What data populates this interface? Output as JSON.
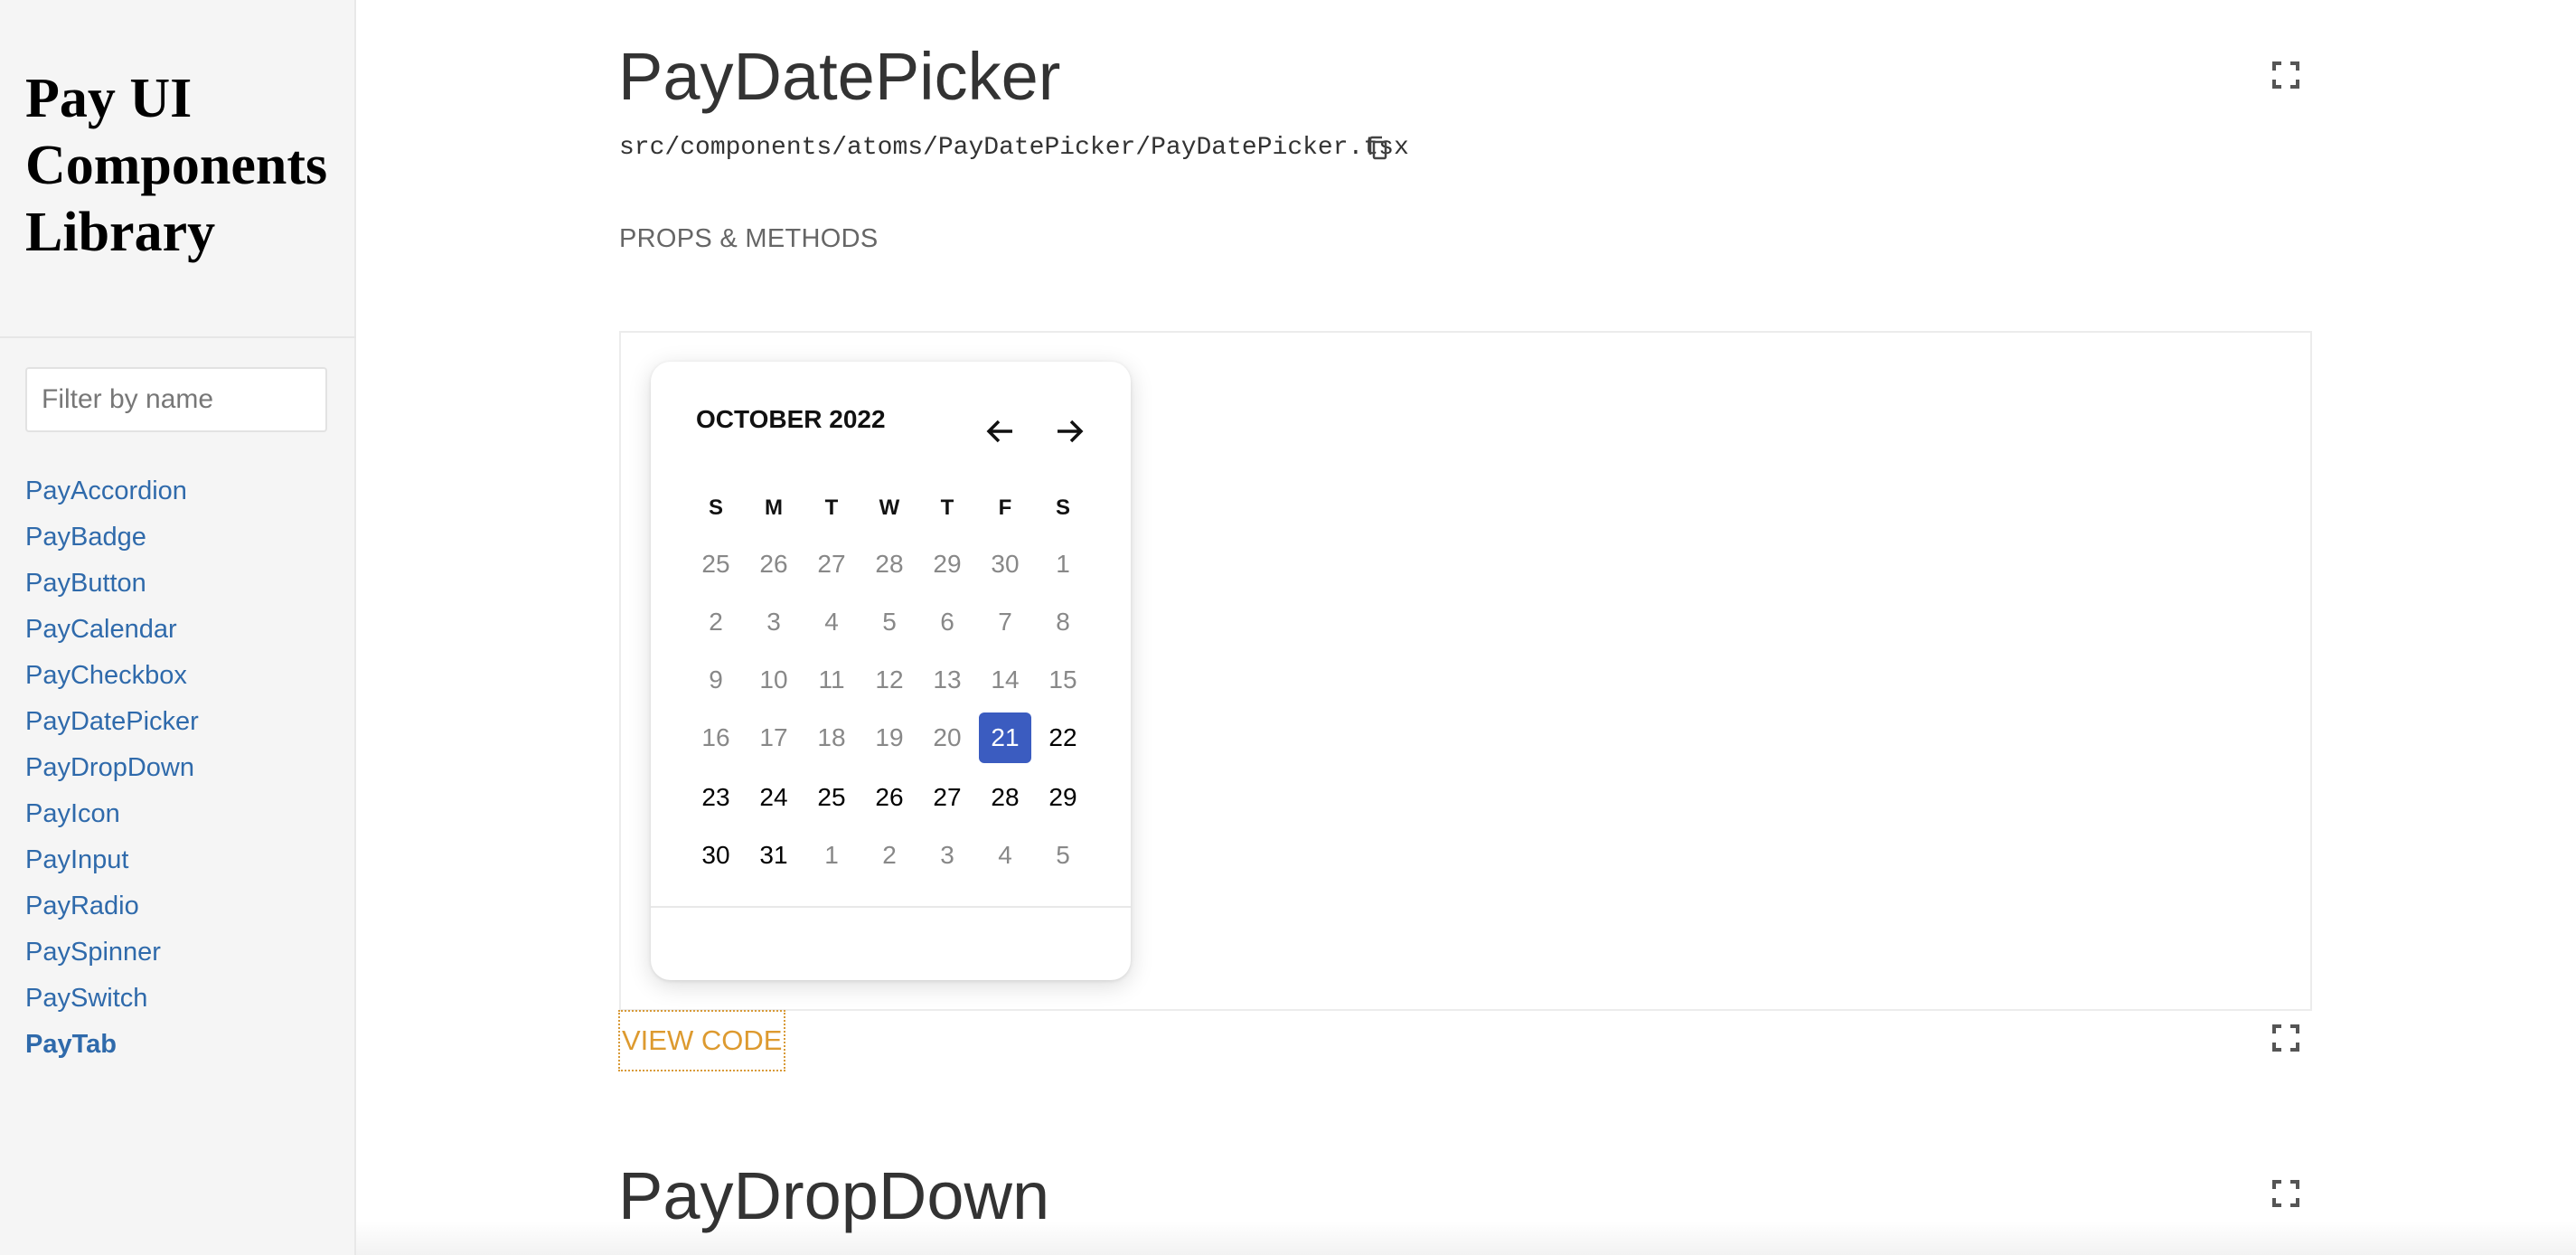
{
  "sidebar": {
    "brand": "Pay UI Components Library",
    "filter_placeholder": "Filter by name",
    "items": [
      {
        "label": "PayAccordion"
      },
      {
        "label": "PayBadge"
      },
      {
        "label": "PayButton"
      },
      {
        "label": "PayCalendar"
      },
      {
        "label": "PayCheckbox"
      },
      {
        "label": "PayDatePicker"
      },
      {
        "label": "PayDropDown"
      },
      {
        "label": "PayIcon"
      },
      {
        "label": "PayInput"
      },
      {
        "label": "PayRadio"
      },
      {
        "label": "PaySpinner"
      },
      {
        "label": "PaySwitch"
      },
      {
        "label": "PayTab"
      }
    ],
    "active_item": "PayTab"
  },
  "main": {
    "section1": {
      "title": "PayDatePicker",
      "path": "src/components/atoms/PayDatePicker/PayDatePicker.tsx",
      "props_label": "PROPS & METHODS",
      "view_code_label": "VIEW CODE"
    },
    "section2": {
      "title": "PayDropDown"
    }
  },
  "calendar": {
    "month_label": "OCTOBER 2022",
    "weekdays": [
      "S",
      "M",
      "T",
      "W",
      "T",
      "F",
      "S"
    ],
    "weeks": [
      [
        {
          "d": "25",
          "m": "other"
        },
        {
          "d": "26",
          "m": "other"
        },
        {
          "d": "27",
          "m": "other"
        },
        {
          "d": "28",
          "m": "other"
        },
        {
          "d": "29",
          "m": "other"
        },
        {
          "d": "30",
          "m": "other"
        },
        {
          "d": "1",
          "m": "other"
        }
      ],
      [
        {
          "d": "2",
          "m": "other"
        },
        {
          "d": "3",
          "m": "other"
        },
        {
          "d": "4",
          "m": "other"
        },
        {
          "d": "5",
          "m": "other"
        },
        {
          "d": "6",
          "m": "other"
        },
        {
          "d": "7",
          "m": "other"
        },
        {
          "d": "8",
          "m": "other"
        }
      ],
      [
        {
          "d": "9",
          "m": "other"
        },
        {
          "d": "10",
          "m": "other"
        },
        {
          "d": "11",
          "m": "other"
        },
        {
          "d": "12",
          "m": "other"
        },
        {
          "d": "13",
          "m": "other"
        },
        {
          "d": "14",
          "m": "other"
        },
        {
          "d": "15",
          "m": "other"
        }
      ],
      [
        {
          "d": "16",
          "m": "other"
        },
        {
          "d": "17",
          "m": "other"
        },
        {
          "d": "18",
          "m": "other"
        },
        {
          "d": "19",
          "m": "other"
        },
        {
          "d": "20",
          "m": "other"
        },
        {
          "d": "21",
          "m": "selected"
        },
        {
          "d": "22",
          "m": "current"
        }
      ],
      [
        {
          "d": "23",
          "m": "current"
        },
        {
          "d": "24",
          "m": "current"
        },
        {
          "d": "25",
          "m": "current"
        },
        {
          "d": "26",
          "m": "current"
        },
        {
          "d": "27",
          "m": "current"
        },
        {
          "d": "28",
          "m": "current"
        },
        {
          "d": "29",
          "m": "current"
        }
      ],
      [
        {
          "d": "30",
          "m": "current"
        },
        {
          "d": "31",
          "m": "current"
        },
        {
          "d": "1",
          "m": "other"
        },
        {
          "d": "2",
          "m": "other"
        },
        {
          "d": "3",
          "m": "other"
        },
        {
          "d": "4",
          "m": "other"
        },
        {
          "d": "5",
          "m": "other"
        }
      ]
    ]
  },
  "colors": {
    "link": "#2f6aab",
    "selected_day": "#3b5cc0",
    "view_code": "#dd9a2f"
  },
  "icons": {
    "copy": "copy-icon",
    "fullscreen": "fullscreen-icon",
    "prev": "arrow-left-icon",
    "next": "arrow-right-icon"
  }
}
